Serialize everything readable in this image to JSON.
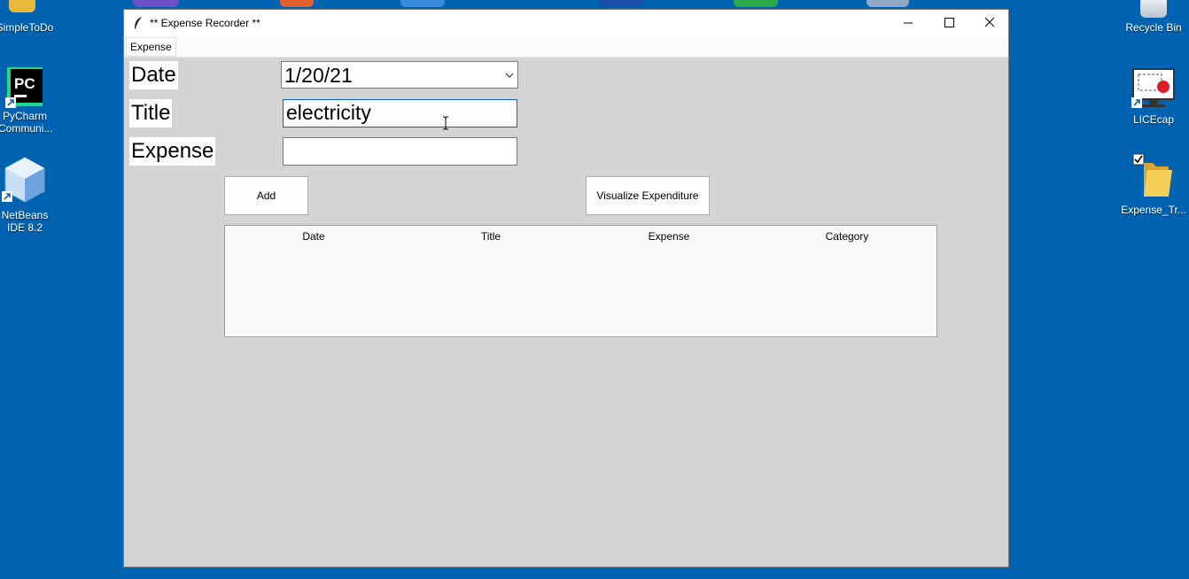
{
  "desktop": {
    "icons_left": [
      {
        "label": "SimpleToDo",
        "icon": "folder-icon"
      },
      {
        "label": "PyCharm Communi...",
        "icon": "pycharm-icon"
      },
      {
        "label": "NetBeans IDE 8.2",
        "icon": "netbeans-icon"
      }
    ],
    "icons_right": [
      {
        "label": "Recycle Bin",
        "icon": "recycle-bin-icon"
      },
      {
        "label": "LICEcap",
        "icon": "licecap-icon"
      },
      {
        "label": "Expense_Tr...",
        "icon": "folder-icon"
      }
    ]
  },
  "window": {
    "title": "** Expense Recorder **",
    "controls": [
      "minimize-icon",
      "maximize-icon",
      "close-icon"
    ],
    "menu": [
      "Expense"
    ]
  },
  "form": {
    "date_label": "Date",
    "date_value": "1/20/21",
    "title_label": "Title",
    "title_value": "electricity",
    "expense_label": "Expense",
    "expense_value": ""
  },
  "buttons": {
    "add": "Add",
    "visualize": "Visualize Expenditure"
  },
  "table": {
    "columns": [
      "Date",
      "Title",
      "Expense",
      "Category"
    ],
    "rows": []
  },
  "colors": {
    "desktop": "#0063b1",
    "window_bg": "#d4d4d4",
    "focus_border": "#0a64c8"
  }
}
